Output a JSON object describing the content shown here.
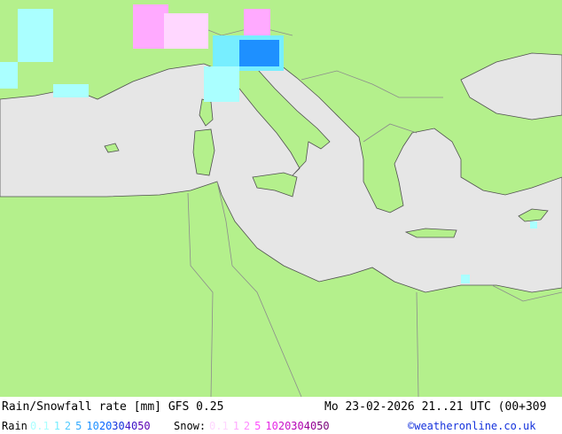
{
  "title": "Rain/Snowfall rate [mm] GFS 0.25",
  "valid_time": "Mo 23-02-2026 21..21 UTC (00+309",
  "credit": "©weatheronline.co.uk",
  "colors": {
    "land": "#b4f08c",
    "sea": "#e6e6e6",
    "border": "#8c8c8c",
    "coast": "#505050"
  },
  "legend": {
    "rain_label": "Rain",
    "rain": [
      {
        "v": "0.1",
        "c": "#aaffff"
      },
      {
        "v": "1",
        "c": "#77eeff"
      },
      {
        "v": "2",
        "c": "#55ccff"
      },
      {
        "v": "5",
        "c": "#33aaff"
      },
      {
        "v": "10",
        "c": "#1e90ff"
      },
      {
        "v": "20",
        "c": "#0a64ff"
      },
      {
        "v": "30",
        "c": "#1432dc"
      },
      {
        "v": "40",
        "c": "#3c14c8"
      },
      {
        "v": "50",
        "c": "#5a00b4"
      }
    ],
    "snow_label": "Snow:",
    "snow": [
      {
        "v": "0.1",
        "c": "#ffd7ff"
      },
      {
        "v": "1",
        "c": "#ffaaff"
      },
      {
        "v": "2",
        "c": "#ff8cff"
      },
      {
        "v": "5",
        "c": "#ff50ff"
      },
      {
        "v": "10",
        "c": "#e628e6"
      },
      {
        "v": "20",
        "c": "#c814c8"
      },
      {
        "v": "30",
        "c": "#b400b4"
      },
      {
        "v": "40",
        "c": "#960096"
      },
      {
        "v": "50",
        "c": "#780078"
      }
    ]
  }
}
